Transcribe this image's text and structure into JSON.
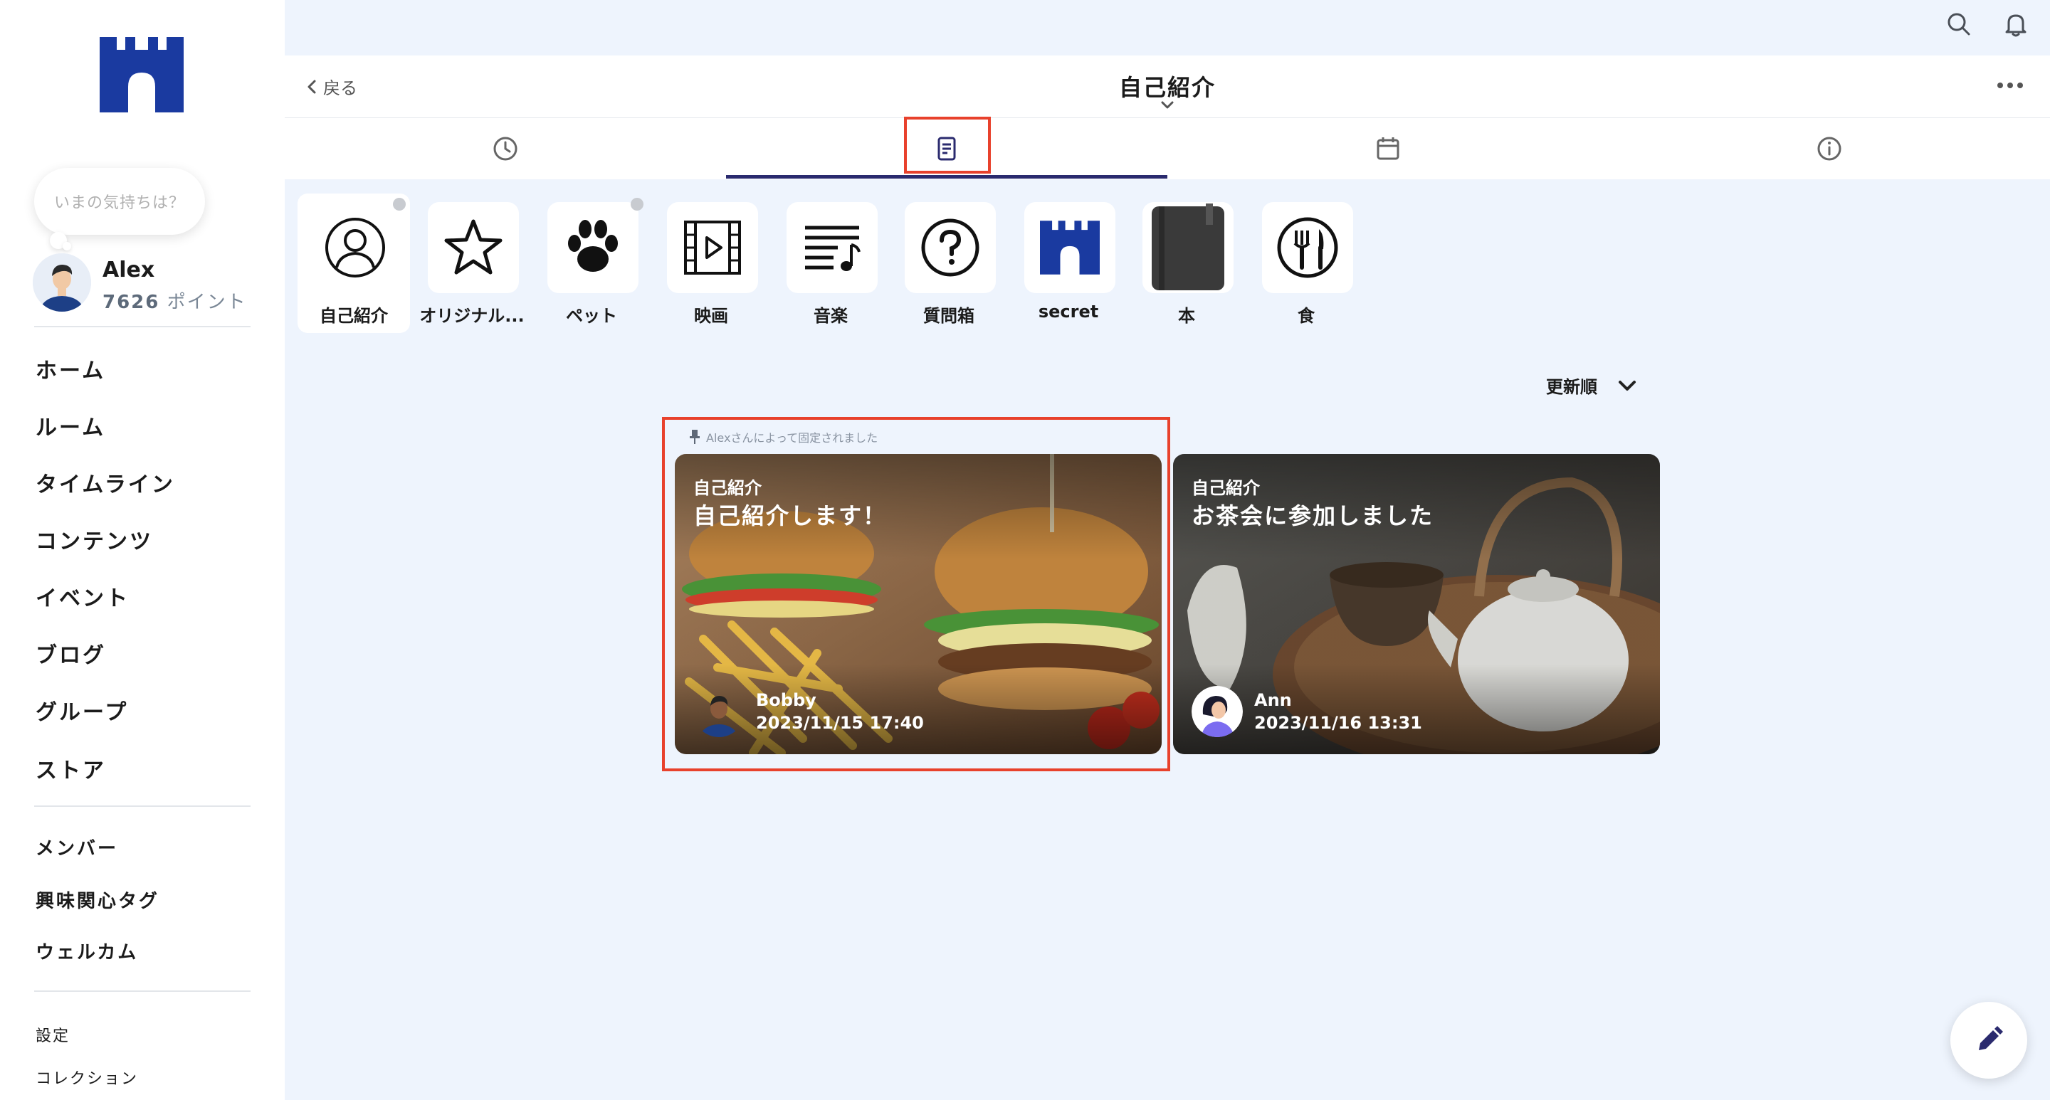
{
  "sidebar": {
    "mood_placeholder": "いまの気持ちは？",
    "user": {
      "name": "Alex",
      "points_value": "7626",
      "points_unit": "ポイント"
    },
    "nav_main": [
      "ホーム",
      "ルーム",
      "タイムライン",
      "コンテンツ",
      "イベント",
      "ブログ",
      "グループ",
      "ストア"
    ],
    "nav_secondary": [
      "メンバー",
      "興味関心タグ",
      "ウェルカム"
    ],
    "nav_footer": [
      "設定",
      "コレクション"
    ]
  },
  "header": {
    "back_label": "戻る",
    "title": "自己紹介"
  },
  "tabs": [
    {
      "icon": "clock-icon"
    },
    {
      "icon": "document-icon",
      "active": true
    },
    {
      "icon": "calendar-icon"
    },
    {
      "icon": "info-icon"
    }
  ],
  "categories": [
    {
      "label": "自己紹介",
      "icon": "person-icon",
      "selected": true,
      "dot": true
    },
    {
      "label": "オリジナル...",
      "icon": "star-icon"
    },
    {
      "label": "ペット",
      "icon": "paw-icon",
      "dot": true
    },
    {
      "label": "映画",
      "icon": "film-icon"
    },
    {
      "label": "音楽",
      "icon": "music-icon"
    },
    {
      "label": "質問箱",
      "icon": "question-icon"
    },
    {
      "label": "secret",
      "icon": "castle-icon"
    },
    {
      "label": "本",
      "icon": "book-icon"
    },
    {
      "label": "食",
      "icon": "food-icon"
    }
  ],
  "sort": {
    "label": "更新順"
  },
  "pinned_label": "Alexさんによって固定されました",
  "cards": [
    {
      "category": "自己紹介",
      "title": "自己紹介します！",
      "author": "Bobby",
      "date": "2023/11/15 17:40"
    },
    {
      "category": "自己紹介",
      "title": "お茶会に参加しました",
      "author": "Ann",
      "date": "2023/11/16 13:31"
    }
  ],
  "colors": {
    "brand": "#1a3aa0",
    "active_tab": "#2a2a6e",
    "highlight": "#e8412c",
    "background": "#eef4fd"
  }
}
